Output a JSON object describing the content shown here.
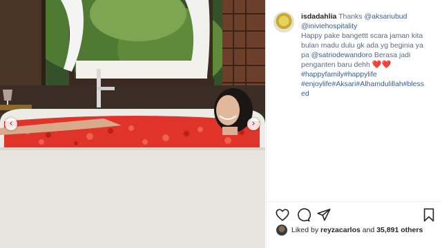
{
  "post": {
    "username": "isdadahlia",
    "caption_intro": "Thanks",
    "mention_1": "@aksariubud",
    "mention_2": "@iniviehospitality",
    "caption_line_1": "Happy pake bangettt scara jaman kita",
    "caption_line_2": "bulan madu dulu gk ada yg beginia ya",
    "caption_line_3_pre": "pa",
    "mention_3": "@satriodewandoro",
    "caption_line_3_post": "Berasa jadi",
    "caption_line_4": "penganten baru dehh",
    "hashtags_line_1": "#happyfamily#happylife",
    "hashtags_line_2": "#enjoylife#Aksari#Alhamdulillah#bless",
    "hashtags_line_3": "ed",
    "heart_glyph": "❤️❤️"
  },
  "likes": {
    "prefix": "Liked by",
    "user": "reyzacarlos",
    "conjunction": "and",
    "count": "35,891 others"
  },
  "icons": {
    "like": "heart-outline-icon",
    "comment": "comment-bubble-icon",
    "share": "paper-plane-icon",
    "save": "bookmark-icon",
    "prev": "chevron-left-icon",
    "next": "chevron-right-icon"
  },
  "nav": {
    "prev_glyph": "‹",
    "next_glyph": "›"
  },
  "colors": {
    "link": "#3b5b8c",
    "heart": "#e0245e",
    "petals": "#e33a2c"
  }
}
